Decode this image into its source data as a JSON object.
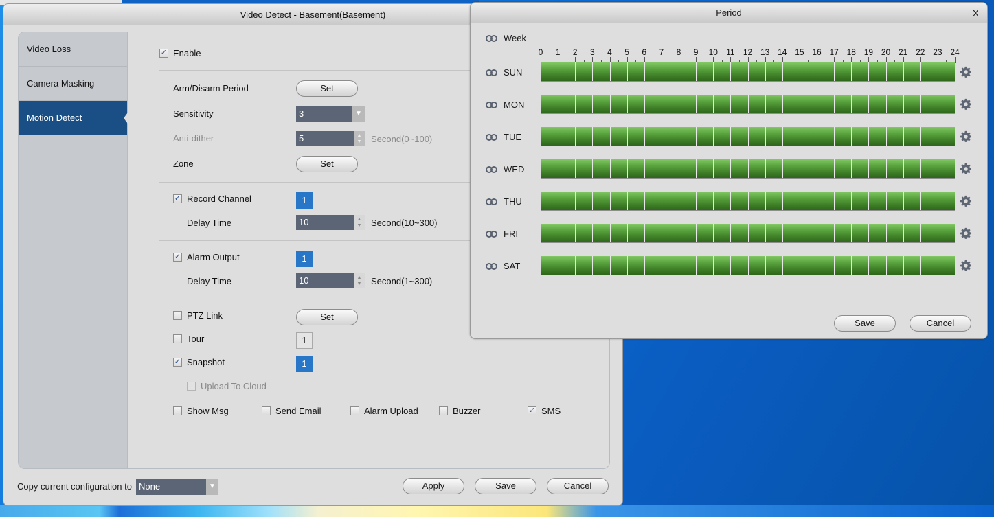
{
  "main_window": {
    "title": "Video Detect - Basement(Basement)",
    "sidebar": [
      {
        "label": "Video Loss",
        "active": false
      },
      {
        "label": "Camera Masking",
        "active": false
      },
      {
        "label": "Motion Detect",
        "active": true
      }
    ],
    "form": {
      "enable": {
        "label": "Enable",
        "checked": true
      },
      "arm_disarm": {
        "label": "Arm/Disarm Period",
        "button": "Set"
      },
      "sensitivity": {
        "label": "Sensitivity",
        "value": "3"
      },
      "anti_dither": {
        "label": "Anti-dither",
        "value": "5",
        "unit": "Second(0~100)"
      },
      "zone": {
        "label": "Zone",
        "button": "Set"
      },
      "record_channel": {
        "label": "Record Channel",
        "checked": true,
        "channel": "1"
      },
      "record_delay": {
        "label": "Delay Time",
        "value": "10",
        "unit": "Second(10~300)"
      },
      "alarm_output": {
        "label": "Alarm Output",
        "checked": true,
        "channel": "1"
      },
      "alarm_delay": {
        "label": "Delay Time",
        "value": "10",
        "unit": "Second(1~300)"
      },
      "ptz_link": {
        "label": "PTZ Link",
        "checked": false,
        "button": "Set"
      },
      "tour": {
        "label": "Tour",
        "checked": false,
        "channel": "1"
      },
      "snapshot": {
        "label": "Snapshot",
        "checked": true,
        "channel": "1"
      },
      "upload_cloud": {
        "label": "Upload To Cloud",
        "checked": false
      },
      "show_msg": {
        "label": "Show Msg",
        "checked": false
      },
      "send_email": {
        "label": "Send Email",
        "checked": false
      },
      "alarm_upload": {
        "label": "Alarm Upload",
        "checked": false
      },
      "buzzer": {
        "label": "Buzzer",
        "checked": false
      },
      "sms": {
        "label": "SMS",
        "checked": true
      }
    },
    "footer": {
      "copy_label": "Copy current configuration to",
      "copy_value": "None",
      "apply": "Apply",
      "save": "Save",
      "cancel": "Cancel"
    }
  },
  "period_dialog": {
    "title": "Period",
    "close": "X",
    "week_label": "Week",
    "hours": [
      "0",
      "1",
      "2",
      "3",
      "4",
      "5",
      "6",
      "7",
      "8",
      "9",
      "10",
      "11",
      "12",
      "13",
      "14",
      "15",
      "16",
      "17",
      "18",
      "19",
      "20",
      "21",
      "22",
      "23",
      "24"
    ],
    "days": [
      {
        "label": "SUN",
        "periods": [
          [
            0,
            24
          ]
        ]
      },
      {
        "label": "MON",
        "periods": [
          [
            0,
            24
          ]
        ]
      },
      {
        "label": "TUE",
        "periods": [
          [
            0,
            24
          ]
        ]
      },
      {
        "label": "WED",
        "periods": [
          [
            0,
            24
          ]
        ]
      },
      {
        "label": "THU",
        "periods": [
          [
            0,
            24
          ]
        ]
      },
      {
        "label": "FRI",
        "periods": [
          [
            0,
            24
          ]
        ]
      },
      {
        "label": "SAT",
        "periods": [
          [
            0,
            24
          ]
        ]
      }
    ],
    "save": "Save",
    "cancel": "Cancel"
  },
  "check_glyph": "✓",
  "arrow_down": "▼",
  "spin_up": "▲",
  "spin_down": "▼"
}
